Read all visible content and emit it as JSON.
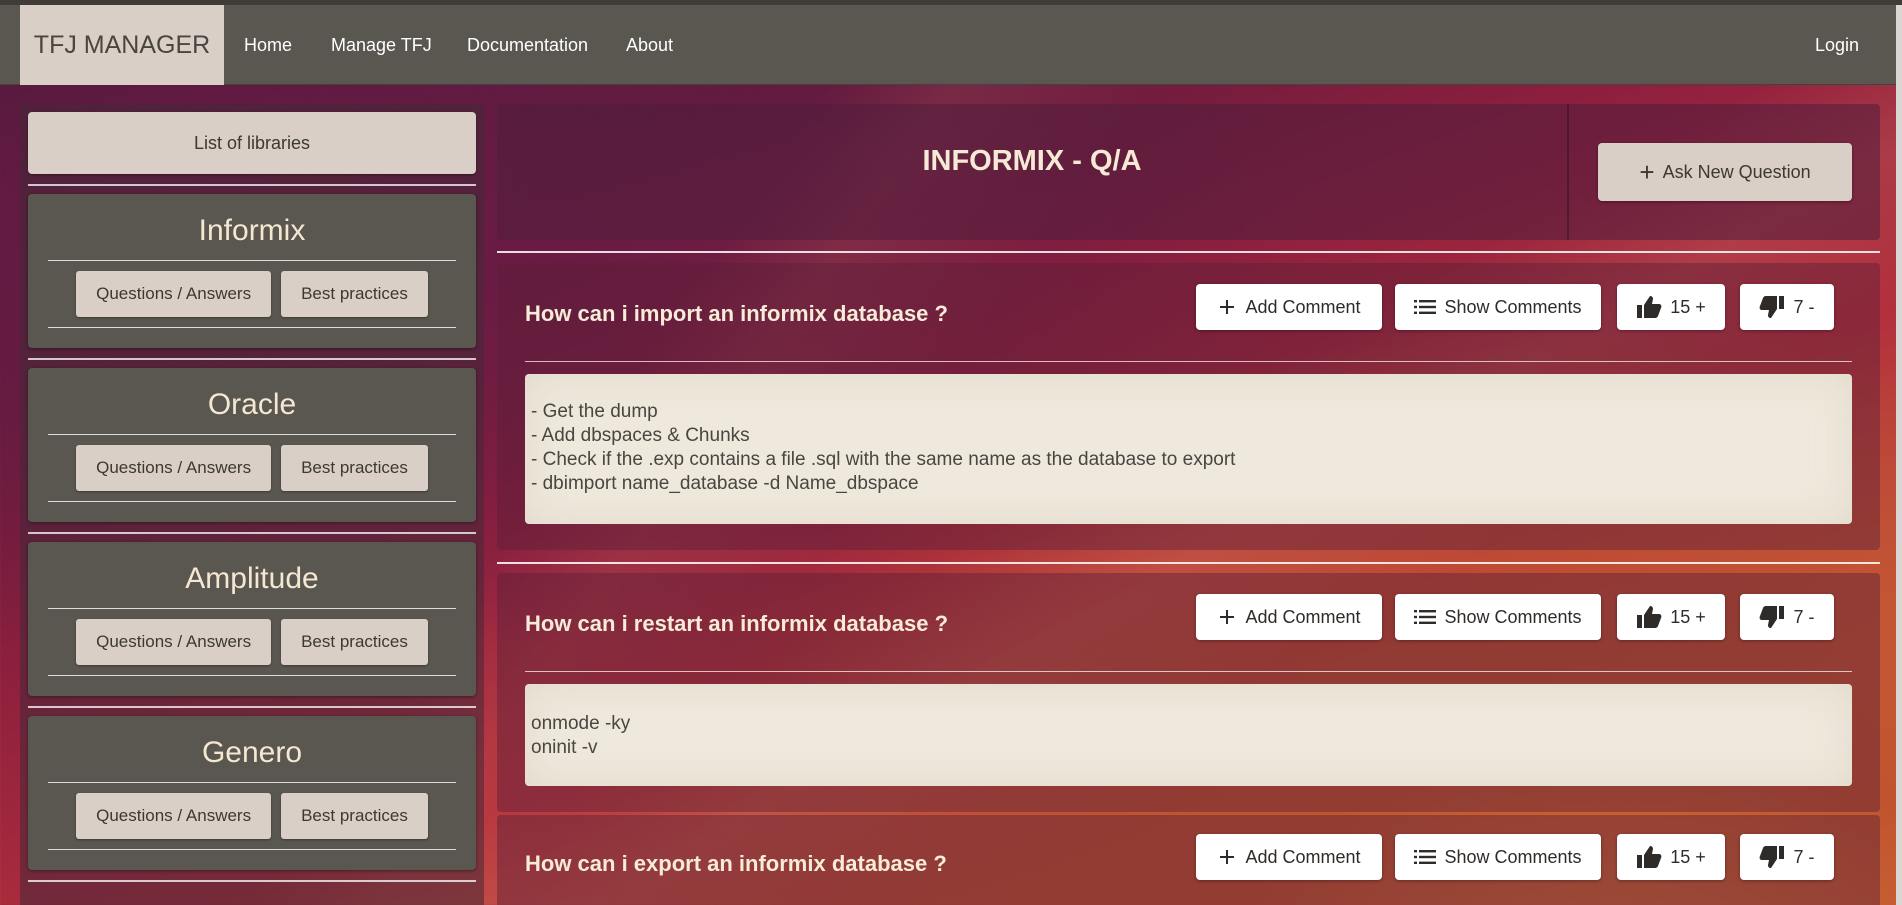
{
  "navbar": {
    "brand": "TFJ MANAGER",
    "links": [
      "Home",
      "Manage TFJ",
      "Documentation",
      "About"
    ],
    "login": "Login"
  },
  "sidebar": {
    "header": "List of libraries",
    "libraries": [
      {
        "name": "Informix",
        "qa": "Questions / Answers",
        "bp": "Best practices"
      },
      {
        "name": "Oracle",
        "qa": "Questions / Answers",
        "bp": "Best practices"
      },
      {
        "name": "Amplitude",
        "qa": "Questions / Answers",
        "bp": "Best practices"
      },
      {
        "name": "Genero",
        "qa": "Questions / Answers",
        "bp": "Best practices"
      }
    ]
  },
  "main": {
    "title": "INFORMIX - Q/A",
    "ask_button": "Ask New Question",
    "questions": [
      {
        "title": "How can i import an informix database ?",
        "add_comment": "Add Comment",
        "show_comments": "Show Comments",
        "upvotes": "15 +",
        "downvotes": "7 -",
        "answer_lines": [
          "- Get the dump",
          "- Add dbspaces & Chunks",
          "- Check if the .exp contains a file .sql with the same name as the database to export",
          "- dbimport name_database -d Name_dbspace"
        ]
      },
      {
        "title": "How can i restart an informix database ?",
        "add_comment": "Add Comment",
        "show_comments": "Show Comments",
        "upvotes": "15 +",
        "downvotes": "7 -",
        "answer_lines": [
          "onmode -ky",
          "oninit -v"
        ]
      },
      {
        "title": "How can i export an informix database ?",
        "add_comment": "Add Comment",
        "show_comments": "Show Comments",
        "upvotes": "15 +",
        "downvotes": "7 -",
        "answer_lines": []
      }
    ]
  },
  "icons": {
    "plus": "plus-icon",
    "list": "list-icon",
    "thumbs_up": "thumbs-up-icon",
    "thumbs_down": "thumbs-down-icon"
  },
  "colors": {
    "navbar": "#5a5650",
    "brand_bg": "#d9cfc6",
    "card": "#5a5650",
    "library_title": "#f4e8d2",
    "answer_bg": "#efe9dd"
  }
}
